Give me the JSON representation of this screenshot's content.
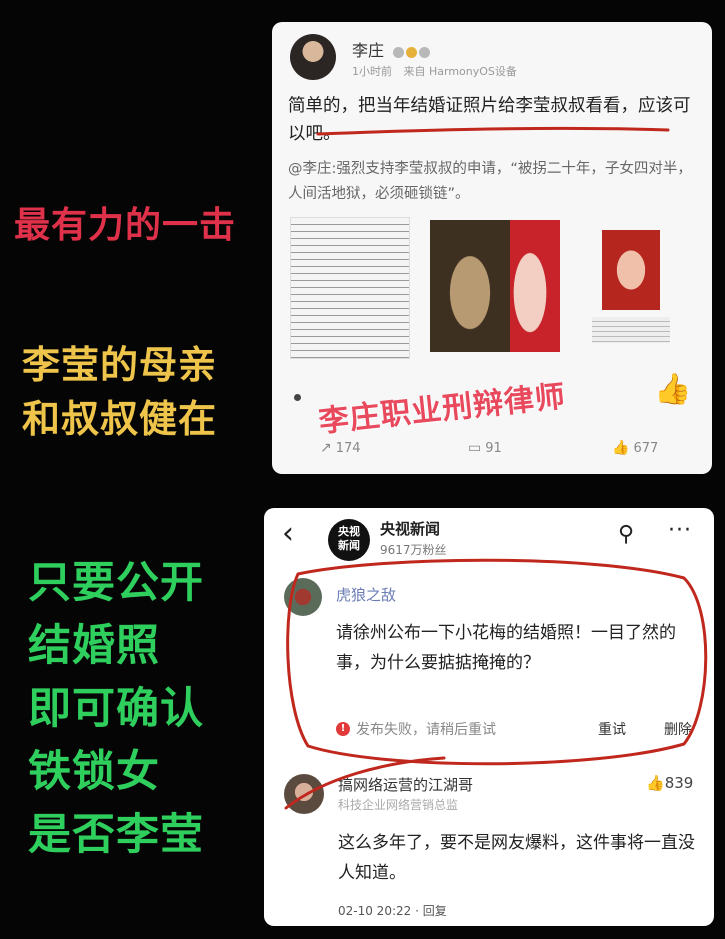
{
  "captions": {
    "c1": "最有力的一击",
    "c2_line1": "李莹的母亲",
    "c2_line2": "和叔叔健在",
    "c3_lines": [
      "只要公开",
      "结婚照",
      "即可确认",
      "铁锁女",
      "是否李莹"
    ]
  },
  "post": {
    "author": "李庄",
    "time": "1小时前",
    "source": "来自 HarmonyOS设备",
    "body": "简单的，把当年结婚证照片给李莹叔叔看看，应该可以吧。",
    "quote": "@李庄:强烈支持李莹叔叔的申请，“被拐二十年，子女四对半，人间活地狱，必须砸锁链”。",
    "watermark": "李庄职业刑辩律师",
    "reposts": "174",
    "comments": "91",
    "likes": "677"
  },
  "weibo": {
    "account_avatar_line1": "央视",
    "account_avatar_line2": "新闻",
    "account_name": "央视新闻",
    "followers": "9617万粉丝",
    "comment1": {
      "author": "虎狼之敌",
      "text": "请徐州公布一下小花梅的结婚照！一目了然的事，为什么要掂掂掩掩的？",
      "fail_notice": "发布失败，请稍后重试",
      "retry_label": "重试",
      "delete_label": "删除"
    },
    "comment2": {
      "author": "搞网络运营的江湖哥",
      "subtitle": "科技企业网络营销总监",
      "likes": "839",
      "text": "这么多年了，要不是网友爆料，这件事将一直没人知道。",
      "time": "02-10 20:22 · 回复"
    }
  },
  "colors": {
    "caption_red": "#e0314a",
    "caption_gold": "#efc44a",
    "caption_green": "#2fcf5e",
    "annotation_red": "#c0281e"
  }
}
